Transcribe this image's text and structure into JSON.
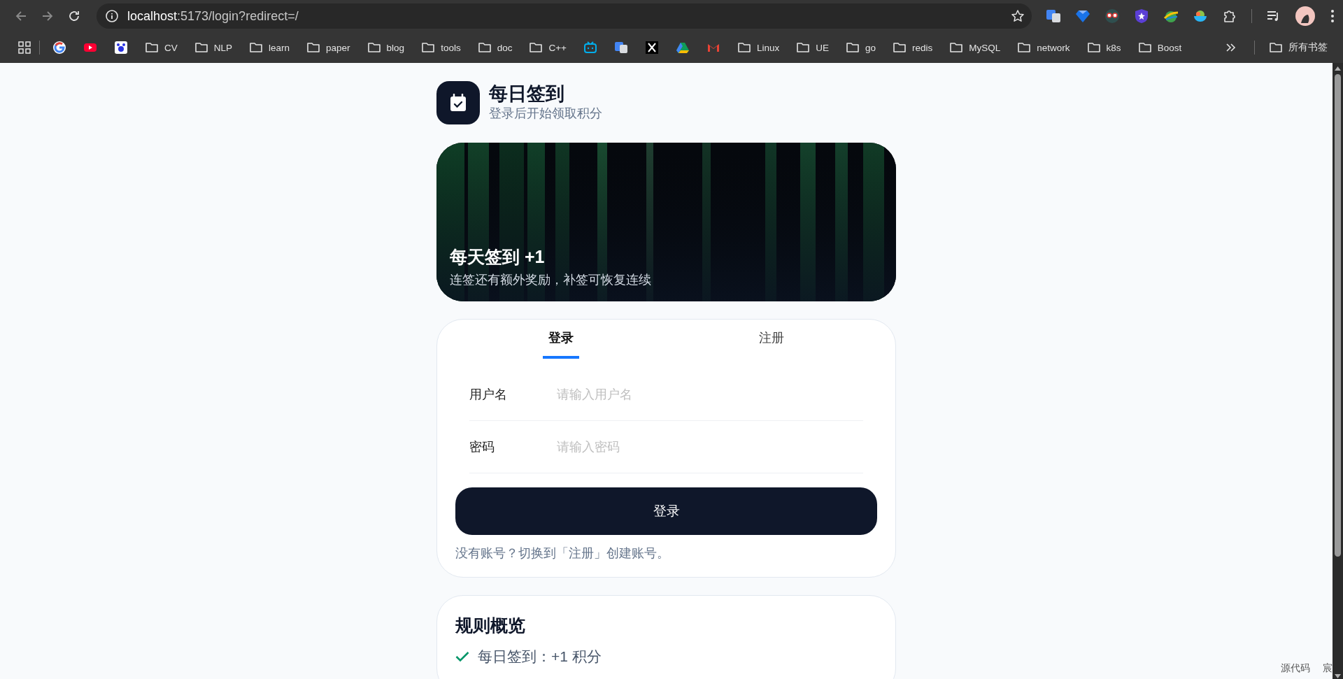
{
  "browser": {
    "url_host": "localhost",
    "url_rest": ":5173/login?redirect=/",
    "bookmarks": [
      {
        "kind": "site"
      },
      {
        "kind": "site"
      },
      {
        "kind": "site"
      },
      {
        "kind": "folder",
        "label": "CV"
      },
      {
        "kind": "folder",
        "label": "NLP"
      },
      {
        "kind": "folder",
        "label": "learn"
      },
      {
        "kind": "folder",
        "label": "paper"
      },
      {
        "kind": "folder",
        "label": "blog"
      },
      {
        "kind": "folder",
        "label": "tools"
      },
      {
        "kind": "folder",
        "label": "doc"
      },
      {
        "kind": "folder",
        "label": "C++"
      },
      {
        "kind": "site"
      },
      {
        "kind": "site"
      },
      {
        "kind": "site"
      },
      {
        "kind": "site"
      },
      {
        "kind": "site"
      },
      {
        "kind": "folder",
        "label": "Linux"
      },
      {
        "kind": "folder",
        "label": "UE"
      },
      {
        "kind": "folder",
        "label": "go"
      },
      {
        "kind": "folder",
        "label": "redis"
      },
      {
        "kind": "folder",
        "label": "MySQL"
      },
      {
        "kind": "folder",
        "label": "network"
      },
      {
        "kind": "folder",
        "label": "k8s"
      },
      {
        "kind": "folder",
        "label": "Boost"
      }
    ],
    "all_bookmarks": "所有书签"
  },
  "header": {
    "title": "每日签到",
    "subtitle": "登录后开始领取积分"
  },
  "banner": {
    "kind": "picture",
    "title": "每天签到 +1",
    "subtitle": "连签还有额外奖励，补签可恢复连续"
  },
  "auth": {
    "tabs": [
      {
        "label": "登录",
        "selected": true
      },
      {
        "label": "注册",
        "selected": false
      }
    ],
    "fields": [
      {
        "label": "用户名",
        "placeholder": "请输入用户名"
      },
      {
        "label": "密码",
        "placeholder": "请输入密码"
      }
    ],
    "submit": "登录",
    "hint": "没有账号？切换到「注册」创建账号。"
  },
  "rules": {
    "title": "规则概览",
    "items": [
      "每日签到：+1 积分"
    ]
  },
  "corner_texts": [
    "源代码",
    "宸"
  ]
}
